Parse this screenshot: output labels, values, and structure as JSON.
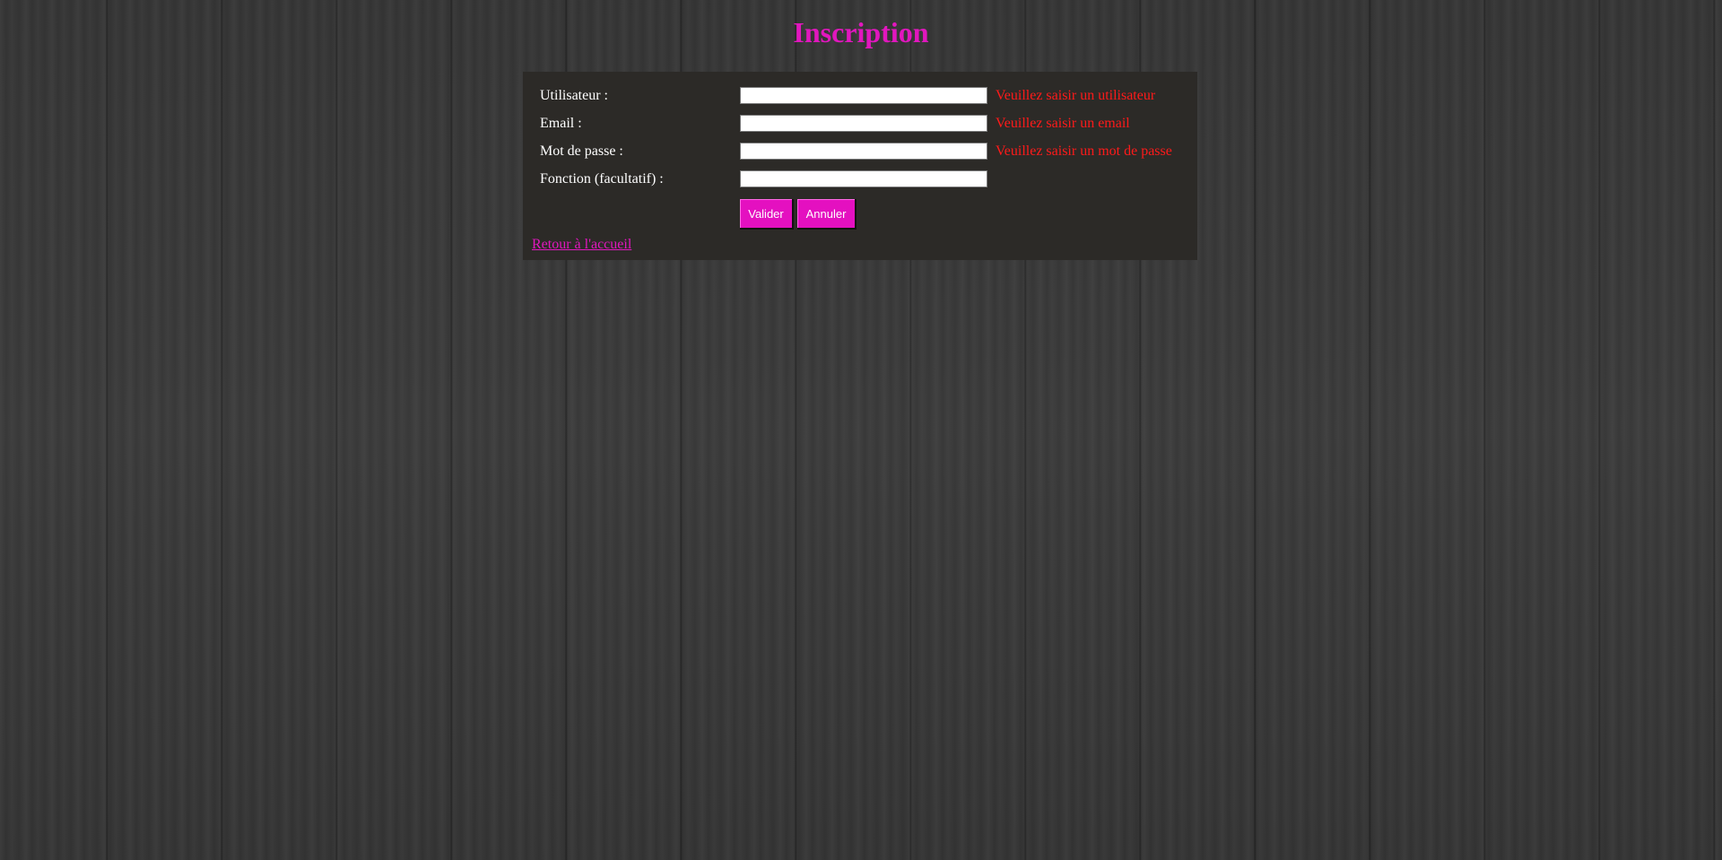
{
  "page": {
    "title": "Inscription"
  },
  "form": {
    "fields": [
      {
        "label": "Utilisateur :",
        "value": "",
        "error": "Veuillez saisir un utilisateur"
      },
      {
        "label": "Email :",
        "value": "",
        "error": "Veuillez saisir un email"
      },
      {
        "label": "Mot de passe :",
        "value": "",
        "error": "Veuillez saisir un mot de passe"
      },
      {
        "label": "Fonction (facultatif) :",
        "value": "",
        "error": ""
      }
    ],
    "submit_label": "Valider",
    "cancel_label": "Annuler",
    "back_link": "Retour à l'accueil"
  },
  "colors": {
    "accent": "#e117be",
    "error": "#ff1a1a",
    "panel_bg": "#2c2a27",
    "label": "#ffffff"
  }
}
